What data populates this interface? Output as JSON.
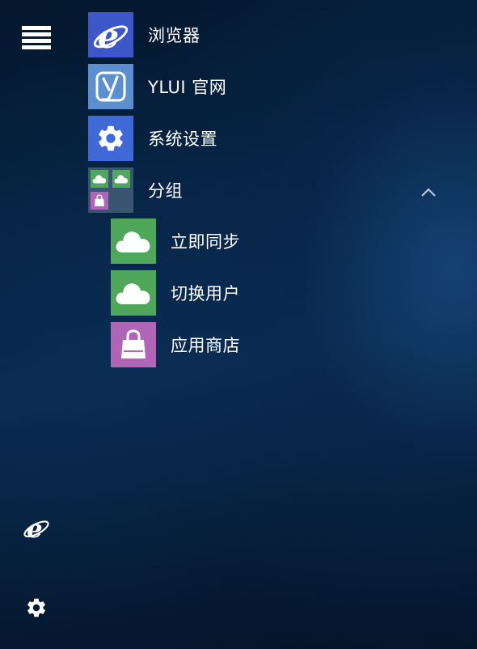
{
  "rail": {
    "menu_icon": "hamburger-menu-icon",
    "browser_icon": "internet-explorer-icon",
    "settings_icon": "gear-icon"
  },
  "menu": {
    "items": [
      {
        "label": "浏览器",
        "icon": "internet-explorer-icon",
        "tile_color": "#3d56c8"
      },
      {
        "label": "YLUI 官网",
        "icon": "ylui-logo-icon",
        "tile_color": "#5b8fd0"
      },
      {
        "label": "系统设置",
        "icon": "gear-icon",
        "tile_color": "#3e69d6"
      },
      {
        "label": "分组",
        "icon": "group-folder-icon",
        "tile_color": "#3a5572",
        "expanded": true
      }
    ],
    "group_items": [
      {
        "label": "立即同步",
        "icon": "cloud-icon",
        "tile_color": "#4fa75c"
      },
      {
        "label": "切换用户",
        "icon": "cloud-icon",
        "tile_color": "#4fa75c"
      },
      {
        "label": "应用商店",
        "icon": "shopping-bag-icon",
        "tile_color": "#b065b7"
      }
    ]
  }
}
